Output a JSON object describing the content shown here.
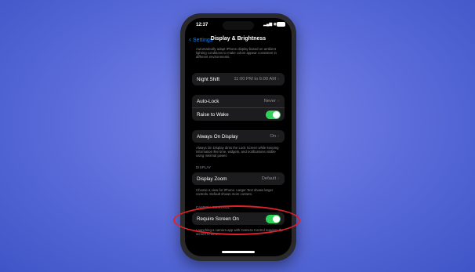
{
  "status_bar": {
    "time": "12:37",
    "signal": "▂▄▆ ◉",
    "battery_icon": "battery-icon"
  },
  "nav": {
    "back_label": "Settings",
    "title": "Display & Brightness"
  },
  "intro_text": "Automatically adapt iPhone display based on ambient lighting conditions to make colors appear consistent in different environments.",
  "night_shift": {
    "label": "Night Shift",
    "value": "11:00 PM to 6:00 AM"
  },
  "auto_lock": {
    "label": "Auto-Lock",
    "value": "Never"
  },
  "raise_to_wake": {
    "label": "Raise to Wake",
    "on": true
  },
  "always_on": {
    "label": "Always On Display",
    "value": "On",
    "note": "Always On Display dims the Lock Screen while keeping information like time, widgets, and notifications visible using minimal power."
  },
  "display_section": {
    "header": "DISPLAY",
    "zoom_label": "Display Zoom",
    "zoom_value": "Default",
    "note": "Choose a view for iPhone. Larger Text shows larger controls. Default shows more content."
  },
  "camera_section": {
    "header": "CAMERA CONTROL",
    "require_label": "Require Screen On",
    "require_on": true,
    "note": "Launching a camera app with Camera Control requires the screen to be on."
  },
  "colors": {
    "accent": "#0a84ff",
    "toggle_on": "#30d158",
    "annotation": "#e0202a"
  }
}
